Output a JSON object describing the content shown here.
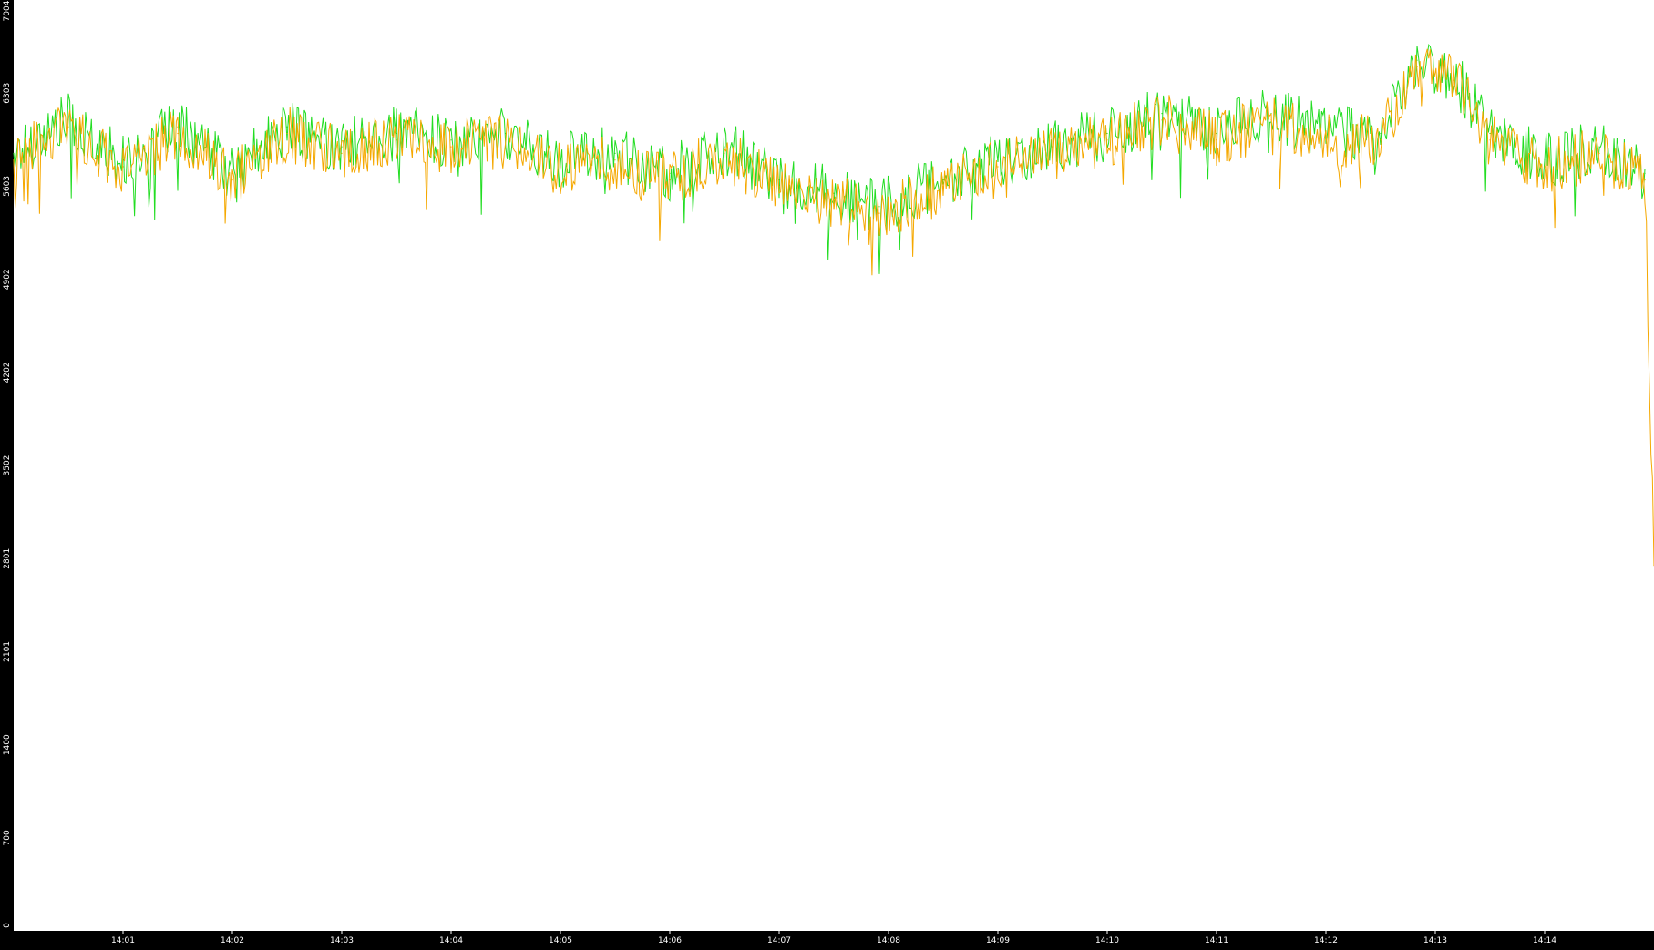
{
  "chart_data": {
    "type": "line",
    "title": "",
    "xlabel": "",
    "ylabel": "",
    "xlim": [
      "14:00",
      "14:15"
    ],
    "ylim": [
      0,
      7004
    ],
    "y_ticks": [
      "0",
      "700",
      "1400",
      "2101",
      "2801",
      "3502",
      "4202",
      "4902",
      "5603",
      "6303",
      "7004"
    ],
    "x_ticks": [
      "14:01",
      "14:02",
      "14:03",
      "14:04",
      "14:05",
      "14:06",
      "14:07",
      "14:08",
      "14:09",
      "14:10",
      "14:11",
      "14:12",
      "14:13",
      "14:14"
    ],
    "grid": false,
    "colors": {
      "background": "#000000",
      "plot_area": "#ffffff",
      "axis_text": "#ffffff",
      "green_series": "#22dd22",
      "orange_series": "#f5a800"
    },
    "series": [
      {
        "color": "#22dd22",
        "x": [
          "14:00:00",
          "14:00:30",
          "14:01:00",
          "14:01:30",
          "14:02:00",
          "14:02:30",
          "14:03:00",
          "14:03:30",
          "14:04:00",
          "14:04:30",
          "14:05:00",
          "14:05:30",
          "14:06:00",
          "14:06:30",
          "14:07:00",
          "14:07:30",
          "14:07:55",
          "14:08:30",
          "14:09:00",
          "14:09:30",
          "14:10:00",
          "14:10:30",
          "14:11:00",
          "14:11:30",
          "14:12:00",
          "14:12:30",
          "14:12:50",
          "14:13:10",
          "14:13:30",
          "14:14:00",
          "14:14:30",
          "14:14:55"
        ],
        "values": [
          5850,
          6100,
          5800,
          6050,
          5700,
          6050,
          5900,
          6000,
          5950,
          6000,
          5800,
          5850,
          5700,
          5900,
          5650,
          5550,
          5450,
          5650,
          5800,
          5900,
          6000,
          6150,
          6000,
          6150,
          6000,
          6000,
          6550,
          6450,
          6000,
          5800,
          5900,
          5700
        ]
      },
      {
        "color": "#f5a800",
        "x": [
          "14:00:00",
          "14:00:30",
          "14:01:00",
          "14:01:30",
          "14:02:00",
          "14:02:30",
          "14:03:00",
          "14:03:30",
          "14:04:00",
          "14:04:30",
          "14:05:00",
          "14:05:30",
          "14:06:00",
          "14:06:30",
          "14:07:00",
          "14:07:30",
          "14:07:55",
          "14:08:30",
          "14:09:00",
          "14:09:30",
          "14:10:00",
          "14:10:30",
          "14:11:00",
          "14:11:30",
          "14:12:00",
          "14:12:30",
          "14:12:50",
          "14:13:10",
          "14:13:30",
          "14:14:00",
          "14:14:30",
          "14:14:55",
          "14:15:00"
        ],
        "values": [
          5800,
          6050,
          5750,
          6000,
          5650,
          6000,
          5850,
          5950,
          5900,
          5950,
          5750,
          5800,
          5650,
          5850,
          5600,
          5500,
          5400,
          5600,
          5750,
          5850,
          5950,
          6100,
          5950,
          6100,
          5950,
          5950,
          6500,
          6400,
          5950,
          5750,
          5850,
          5650,
          2750
        ]
      }
    ]
  }
}
